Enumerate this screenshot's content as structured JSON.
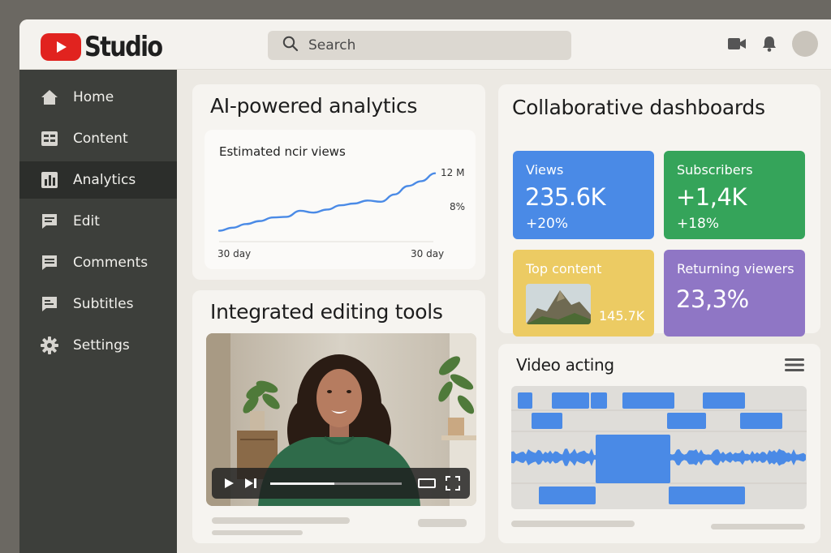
{
  "app": {
    "logo_text": "Studio",
    "search_placeholder": "Search",
    "header_icons": [
      "video-camera-icon",
      "bell-icon"
    ]
  },
  "sidebar": {
    "items": [
      {
        "label": "Home",
        "icon": "home-icon"
      },
      {
        "label": "Content",
        "icon": "content-grid-icon"
      },
      {
        "label": "Analytics",
        "icon": "bar-chart-icon",
        "active": true
      },
      {
        "label": "Edit",
        "icon": "edit-icon"
      },
      {
        "label": "Comments",
        "icon": "comment-icon"
      },
      {
        "label": "Subtitles",
        "icon": "subtitles-icon"
      },
      {
        "label": "Settings",
        "icon": "gear-icon"
      }
    ]
  },
  "analytics_card": {
    "title": "AI-powered analytics",
    "chart_data": {
      "type": "line",
      "title": "Estimated ncir views",
      "x_start_label": "30 day",
      "x_end_label": "30 day",
      "y_labels": [
        "12 M",
        "8%"
      ],
      "series": [
        {
          "values": [
            1.0,
            1.5,
            2.1,
            2.6,
            3.2,
            3.3,
            4.3,
            4.0,
            4.5,
            5.2,
            5.5,
            6.0,
            5.8,
            7.0,
            8.4,
            9.2,
            10.5
          ]
        }
      ],
      "line_color": "#4a8ae6"
    }
  },
  "editing_card": {
    "title": "Integrated editing tools",
    "progress": 0.49
  },
  "collab_card": {
    "title": "Collaborative dashboards",
    "tiles": {
      "views": {
        "label": "Views",
        "value": "235.6K",
        "delta": "+20%",
        "color": "#4a8ae6"
      },
      "subscribers": {
        "label": "Subscribers",
        "value": "+1,4K",
        "delta": "+18%",
        "color": "#35a45a"
      },
      "top_content": {
        "label": "Top content",
        "value": "145.7K",
        "color": "#eccb63"
      },
      "returning": {
        "label": "Returning viewers",
        "value": "23,3%",
        "color": "#8f76c5"
      }
    }
  },
  "timeline_card": {
    "title": "Video acting"
  }
}
